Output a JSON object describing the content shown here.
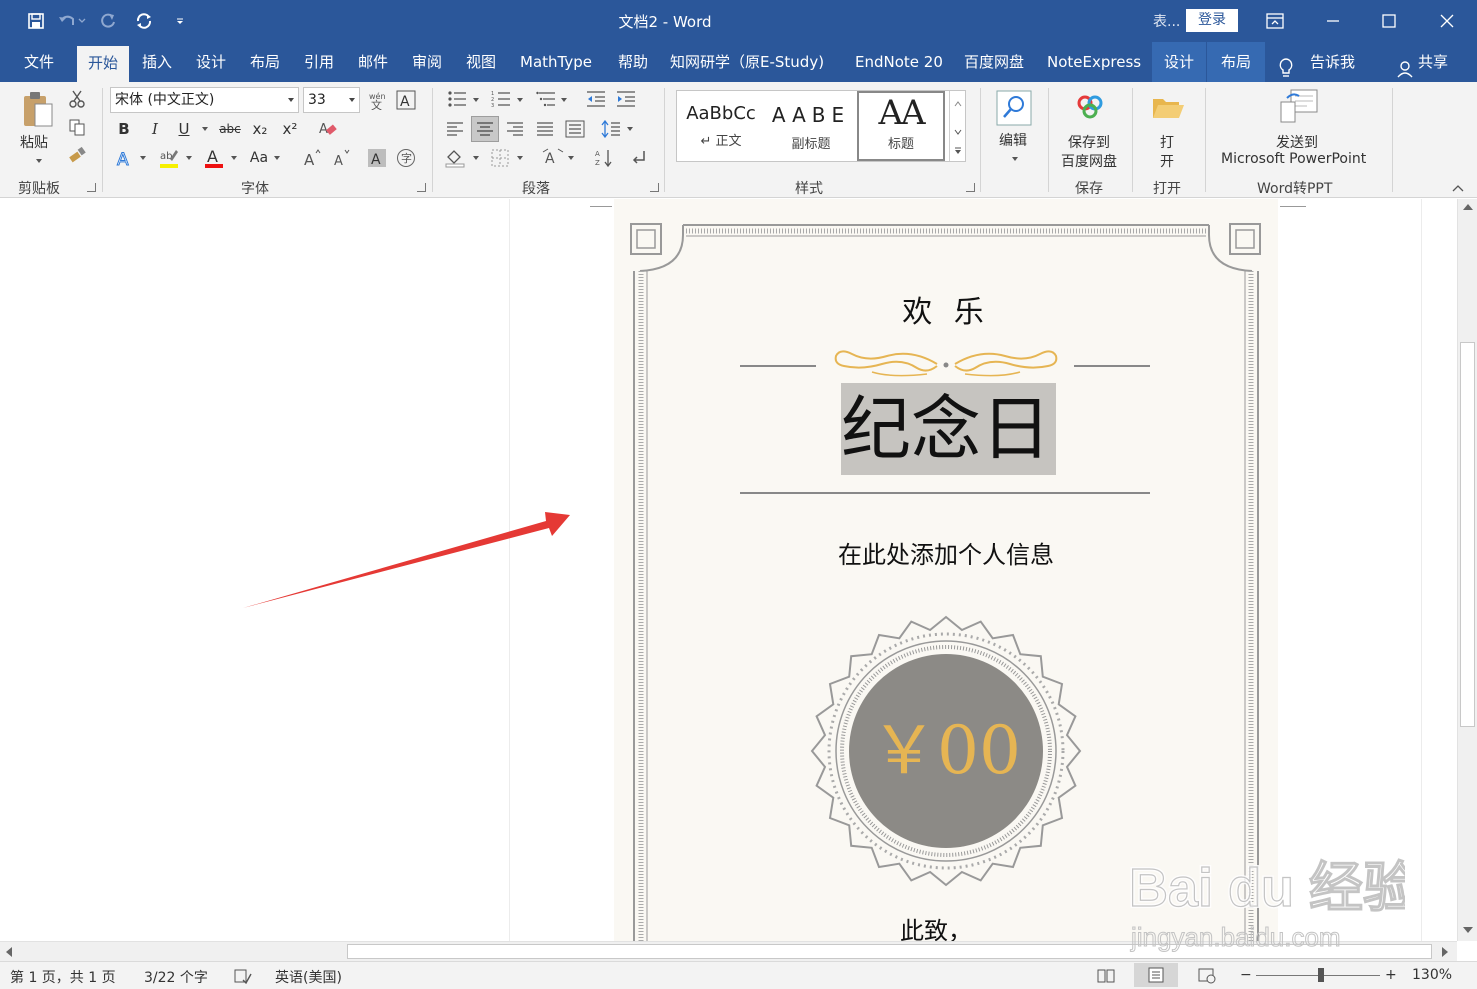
{
  "window": {
    "title": "文档2  -  Word",
    "context_label": "表...",
    "login": "登录"
  },
  "tabs": [
    "文件",
    "开始",
    "插入",
    "设计",
    "布局",
    "引用",
    "邮件",
    "审阅",
    "视图",
    "MathType",
    "帮助",
    "知网研学（原E-Study)",
    "EndNote 20",
    "百度网盘",
    "NoteExpress",
    "设计",
    "布局"
  ],
  "active_tab": "开始",
  "tell_me": "告诉我",
  "share": "共享",
  "ribbon": {
    "clipboard": {
      "paste": "粘贴",
      "group": "剪贴板"
    },
    "font": {
      "name": "宋体 (中文正文)",
      "size": "33",
      "group": "字体",
      "bold": "B",
      "italic": "I",
      "underline": "U",
      "strike": "abc",
      "sub": "x₂",
      "sup": "x²",
      "case": "Aa"
    },
    "paragraph": {
      "group": "段落"
    },
    "styles": {
      "items": [
        {
          "sample": "AaBbCc",
          "name": "↵ 正文"
        },
        {
          "sample": "AABE",
          "name": "副标题"
        },
        {
          "sample": "AA",
          "name": "标题"
        }
      ],
      "group": "样式"
    },
    "editing": {
      "label": "编辑"
    },
    "save": {
      "label_line1": "保存到",
      "label_line2": "百度网盘",
      "group": "保存"
    },
    "open": {
      "label_line1": "打",
      "label_line2": "开",
      "group": "打开"
    },
    "word2ppt": {
      "label_line1": "发送到",
      "label_line2": "Microsoft PowerPoint",
      "group": "Word转PPT"
    }
  },
  "document": {
    "heading": "欢 乐",
    "title": "纪念日",
    "info": "在此处添加个人信息",
    "amount": "￥00",
    "closing": "此致，"
  },
  "status": {
    "page": "第 1 页，共 1 页",
    "words": "3/22 个字",
    "language": "英语(美国)",
    "zoom": "130%"
  },
  "watermark": {
    "brand": "Bai du 经验",
    "url": "jingyan.baidu.com"
  },
  "colors": {
    "titlebar": "#2b579a",
    "gold": "#e6b553",
    "seal": "#8c8a86",
    "arrow": "#e53935"
  }
}
